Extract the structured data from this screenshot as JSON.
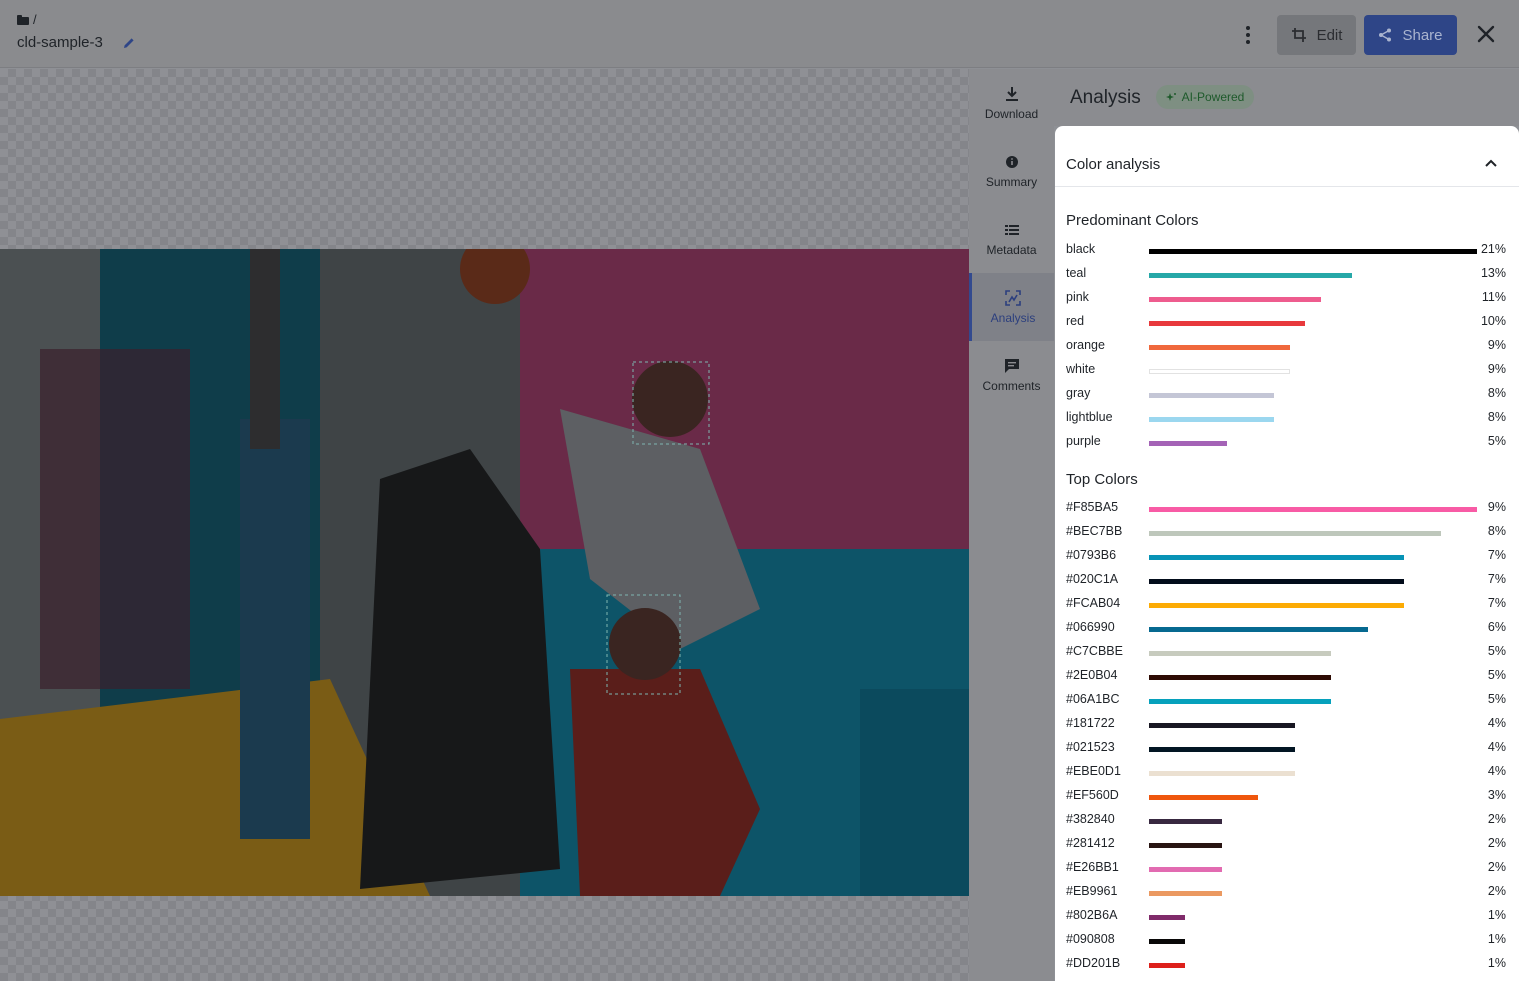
{
  "header": {
    "breadcrumb_sep": "/",
    "asset_name": "cld-sample-3",
    "edit_label": "Edit",
    "share_label": "Share"
  },
  "rail": {
    "items": [
      {
        "label": "Download",
        "icon": "download-icon",
        "active": false
      },
      {
        "label": "Summary",
        "icon": "info-icon",
        "active": false
      },
      {
        "label": "Metadata",
        "icon": "list-icon",
        "active": false
      },
      {
        "label": "Analysis",
        "icon": "analysis-icon",
        "active": true
      },
      {
        "label": "Comments",
        "icon": "comment-icon",
        "active": false
      }
    ]
  },
  "panel": {
    "title": "Analysis",
    "badge": "AI-Powered",
    "section_label": "Color analysis",
    "predominant_title": "Predominant Colors",
    "predominant": [
      {
        "name": "black",
        "pct": 21,
        "label": "21%",
        "color": "#000000"
      },
      {
        "name": "teal",
        "pct": 13,
        "label": "13%",
        "color": "#26a8a8"
      },
      {
        "name": "pink",
        "pct": 11,
        "label": "11%",
        "color": "#ee5c8e"
      },
      {
        "name": "red",
        "pct": 10,
        "label": "10%",
        "color": "#e8393c"
      },
      {
        "name": "orange",
        "pct": 9,
        "label": "9%",
        "color": "#f0683c"
      },
      {
        "name": "white",
        "pct": 9,
        "label": "9%",
        "color": "#ffffff"
      },
      {
        "name": "gray",
        "pct": 8,
        "label": "8%",
        "color": "#c4c6d6"
      },
      {
        "name": "lightblue",
        "pct": 8,
        "label": "8%",
        "color": "#9bd7ef"
      },
      {
        "name": "purple",
        "pct": 5,
        "label": "5%",
        "color": "#a463b6"
      }
    ],
    "top_title": "Top Colors",
    "top": [
      {
        "name": "#F85BA5",
        "pct": 9,
        "label": "9%",
        "color": "#F85BA5"
      },
      {
        "name": "#BEC7BB",
        "pct": 8,
        "label": "8%",
        "color": "#BEC7BB"
      },
      {
        "name": "#0793B6",
        "pct": 7,
        "label": "7%",
        "color": "#0793B6"
      },
      {
        "name": "#020C1A",
        "pct": 7,
        "label": "7%",
        "color": "#020C1A"
      },
      {
        "name": "#FCAB04",
        "pct": 7,
        "label": "7%",
        "color": "#FCAB04"
      },
      {
        "name": "#066990",
        "pct": 6,
        "label": "6%",
        "color": "#066990"
      },
      {
        "name": "#C7CBBE",
        "pct": 5,
        "label": "5%",
        "color": "#C7CBBE"
      },
      {
        "name": "#2E0B04",
        "pct": 5,
        "label": "5%",
        "color": "#2E0B04"
      },
      {
        "name": "#06A1BC",
        "pct": 5,
        "label": "5%",
        "color": "#06A1BC"
      },
      {
        "name": "#181722",
        "pct": 4,
        "label": "4%",
        "color": "#181722"
      },
      {
        "name": "#021523",
        "pct": 4,
        "label": "4%",
        "color": "#021523"
      },
      {
        "name": "#EBE0D1",
        "pct": 4,
        "label": "4%",
        "color": "#EBE0D1"
      },
      {
        "name": "#EF560D",
        "pct": 3,
        "label": "3%",
        "color": "#EF560D"
      },
      {
        "name": "#382840",
        "pct": 2,
        "label": "2%",
        "color": "#382840"
      },
      {
        "name": "#281412",
        "pct": 2,
        "label": "2%",
        "color": "#281412"
      },
      {
        "name": "#E26BB1",
        "pct": 2,
        "label": "2%",
        "color": "#E26BB1"
      },
      {
        "name": "#EB9961",
        "pct": 2,
        "label": "2%",
        "color": "#EB9961"
      },
      {
        "name": "#802B6A",
        "pct": 1,
        "label": "1%",
        "color": "#802B6A"
      },
      {
        "name": "#090808",
        "pct": 1,
        "label": "1%",
        "color": "#090808"
      },
      {
        "name": "#DD201B",
        "pct": 1,
        "label": "1%",
        "color": "#DD201B"
      }
    ]
  }
}
